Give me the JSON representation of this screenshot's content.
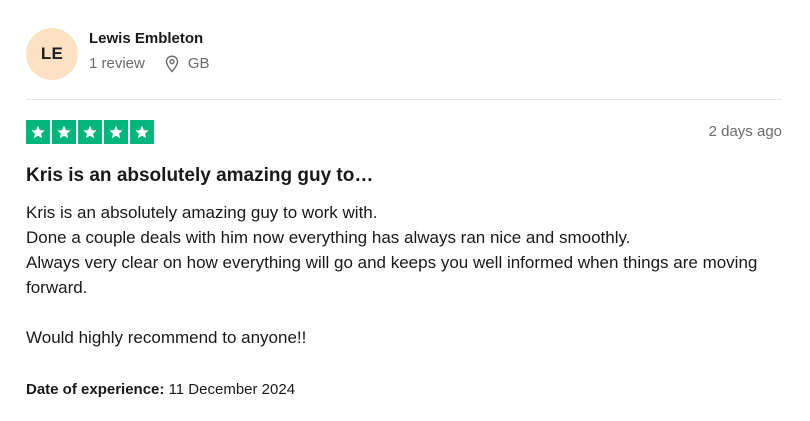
{
  "reviewer": {
    "initials": "LE",
    "name": "Lewis Embleton",
    "review_count": "1 review",
    "country": "GB"
  },
  "rating": {
    "stars": 5,
    "max": 5
  },
  "posted": "2 days ago",
  "review": {
    "title": "Kris is an absolutely amazing guy to…",
    "lines": [
      "Kris is an absolutely amazing guy to work with.",
      "Done a couple deals with him now everything has always ran nice and smoothly.",
      "Always very clear on how everything will go and keeps you well informed when things are moving forward."
    ],
    "closing": "Would highly recommend to anyone!!"
  },
  "experience": {
    "label": "Date of experience:",
    "date": "11 December 2024"
  },
  "colors": {
    "star_green": "#00b67a",
    "avatar_bg": "#fde1c3",
    "muted_text": "#6a6a6a"
  },
  "icons": {
    "location": "location-pin-icon",
    "star": "star-icon"
  }
}
